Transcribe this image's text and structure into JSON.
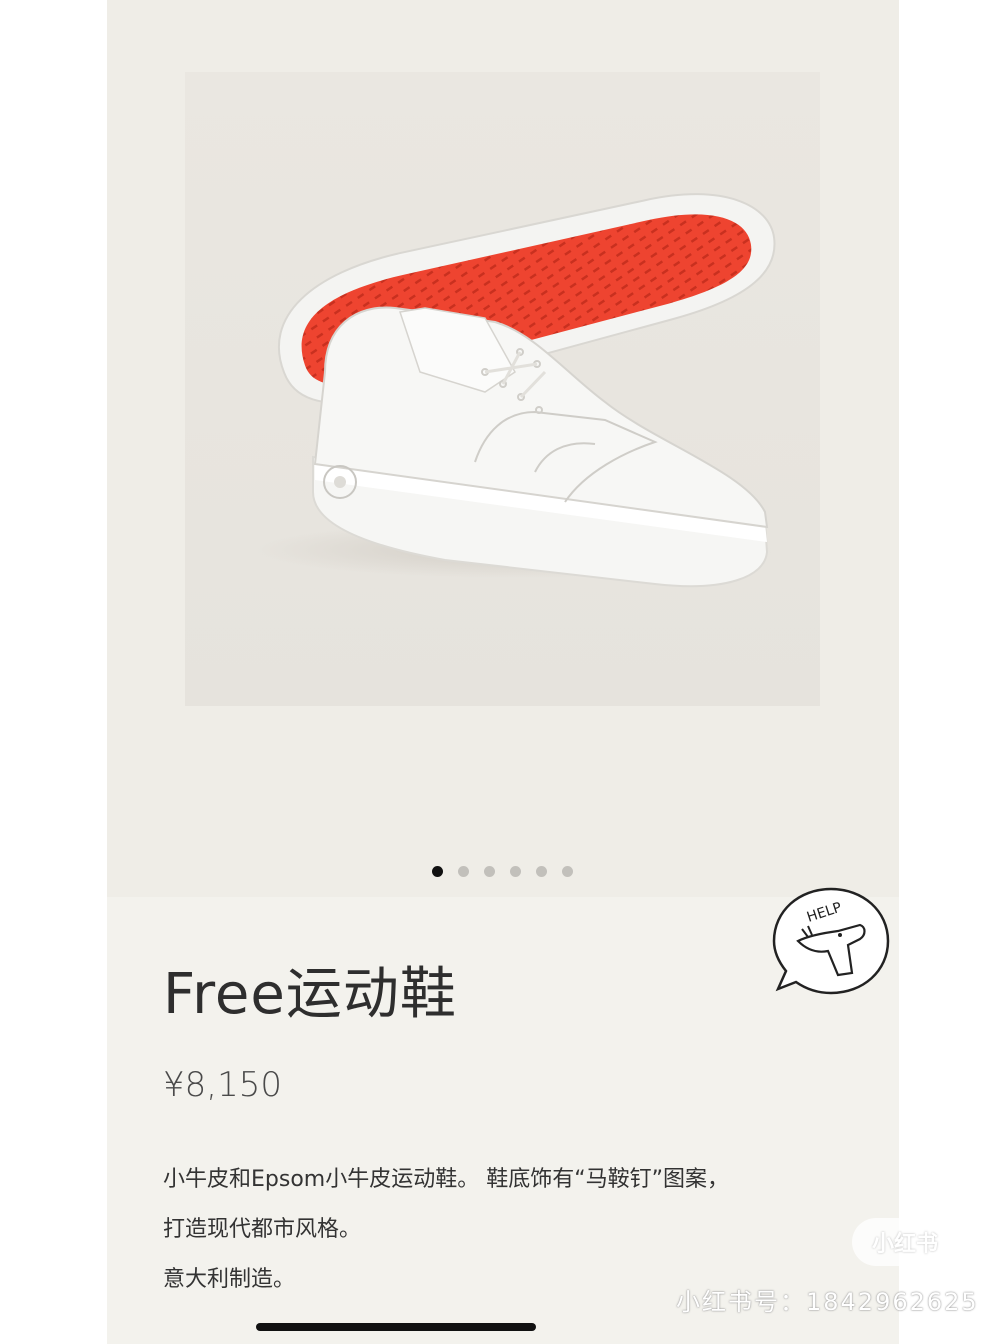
{
  "product": {
    "title": "Free运动鞋",
    "price": "¥8,150",
    "description": [
      "小牛皮和Epsom小牛皮运动鞋。 鞋底饰有“马鞍钉”图案，",
      "打造现代都市风格。",
      "意大利制造。"
    ]
  },
  "gallery": {
    "slides": 6,
    "active_index": 0
  },
  "help": {
    "label": "HELP"
  },
  "watermark": {
    "logo": "小红书",
    "id_text": "小红书号：1842962625"
  },
  "colors": {
    "sole_red": "#f0432f",
    "accent": "#111111"
  }
}
